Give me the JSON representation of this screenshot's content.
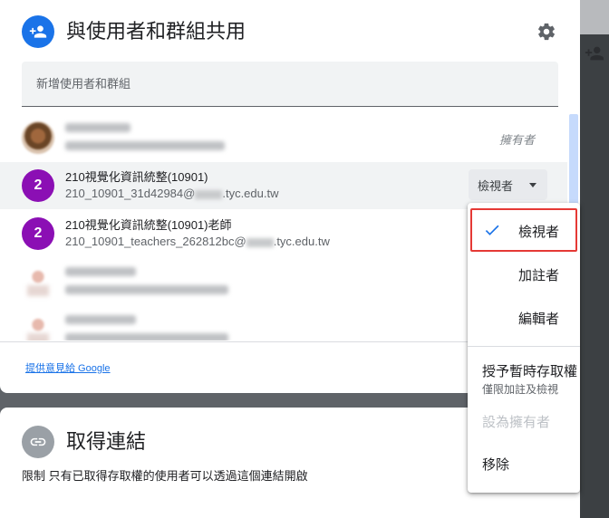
{
  "dialog": {
    "title": "與使用者和群組共用",
    "add_placeholder": "新增使用者和群組",
    "feedback_link": "提供意見給 Google",
    "people": [
      {
        "name": "",
        "email": "",
        "role": "擁有者"
      },
      {
        "name": "210視覺化資訊統整(10901)",
        "avatar_letter": "2",
        "email_prefix": "210_10901_31d42984@",
        "email_suffix": ".tyc.edu.tw",
        "role": "檢視者"
      },
      {
        "name": "210視覺化資訊統整(10901)老師",
        "avatar_letter": "2",
        "email_prefix": "210_10901_teachers_262812bc@",
        "email_suffix": ".tyc.edu.tw"
      },
      {
        "name": "",
        "email": ""
      },
      {
        "name": "",
        "email": ""
      }
    ]
  },
  "link_section": {
    "title": "取得連結",
    "description": "限制 只有已取得存取權的使用者可以透過這個連結開啟"
  },
  "role_menu": {
    "items": [
      {
        "label": "檢視者",
        "checked": true
      },
      {
        "label": "加註者",
        "checked": false
      },
      {
        "label": "編輯者",
        "checked": false
      }
    ],
    "temp_access": "授予暫時存取權",
    "temp_access_sub": "僅限加註及檢視",
    "make_owner": "設為擁有者",
    "remove": "移除"
  },
  "colors": {
    "accent": "#1a73e8",
    "avatar_purple": "#8b0fb4",
    "highlight_box": "#e53935"
  },
  "icons": [
    "person-add-icon",
    "gear-icon",
    "link-icon",
    "checkmark-icon",
    "caret-down-icon"
  ]
}
